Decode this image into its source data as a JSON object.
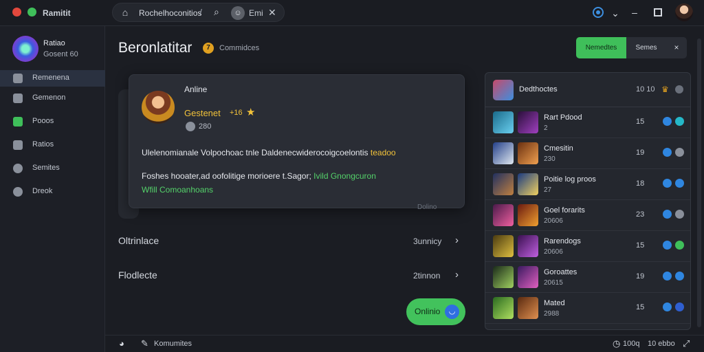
{
  "app": {
    "name": "Ramitit"
  },
  "tabbar": {
    "title": "Rochelhoconitios",
    "separator": "/",
    "profile_name": "Emi"
  },
  "sidebar": {
    "profile": {
      "name": "Ratiao",
      "subtitle": "Gosent 60"
    },
    "items": [
      {
        "label": "Remenena"
      },
      {
        "label": "Gemenon"
      },
      {
        "label": "Pooos"
      },
      {
        "label": "Ratios"
      },
      {
        "label": "Semites"
      },
      {
        "label": "Dreok"
      }
    ]
  },
  "main": {
    "title": "Beronlatitar",
    "title_badge": "7",
    "title_subtitle": "Commidces",
    "buttons": {
      "primary": "Nemedtes",
      "secondary": "Semes",
      "close": "×"
    },
    "card": {
      "status": "Anline",
      "name": "Gestenet",
      "level": "+16",
      "points": "280",
      "line1": "Ulelenomianale Volpochoac tnle  Daldenecwiderocoigcoelontis",
      "line1_accent": "teadoo",
      "line2": "Foshes hooater,ad oofolitige morioere t.Sagor;",
      "line2_accent": "Ivild Gnongcuron",
      "line3": "Wfill Comoanhoans",
      "ghost_label": "Dolino"
    },
    "rows": [
      {
        "label": "Oltrinlace",
        "value": "3unnicy"
      },
      {
        "label": "Flodlecte",
        "value": "2tinnon"
      }
    ],
    "online_button": "Onlinio"
  },
  "friends": {
    "header": {
      "title": "Dedthoctes",
      "count": "10 10"
    },
    "list": [
      {
        "name": "Rart Pdood",
        "status": "2",
        "count": "15"
      },
      {
        "name": "Cmesitin",
        "status": "230",
        "count": "19"
      },
      {
        "name": "Poitie log proos",
        "status": "27",
        "count": "18"
      },
      {
        "name": "Goel forarits",
        "status": "20606",
        "count": "23"
      },
      {
        "name": "Rarendogs",
        "status": "20606",
        "count": "15"
      },
      {
        "name": "Goroattes",
        "status": "20615",
        "count": "19"
      },
      {
        "name": "Mated",
        "status": "2988",
        "count": "15"
      }
    ]
  },
  "bottombar": {
    "label": "Komumites",
    "stat1": "100q",
    "stat2": "10 ebbo"
  },
  "colors": {
    "accent_green": "#3fbf5a",
    "accent_blue": "#2f86e0",
    "accent_gold": "#f2c23a",
    "background": "#1b1d23"
  }
}
